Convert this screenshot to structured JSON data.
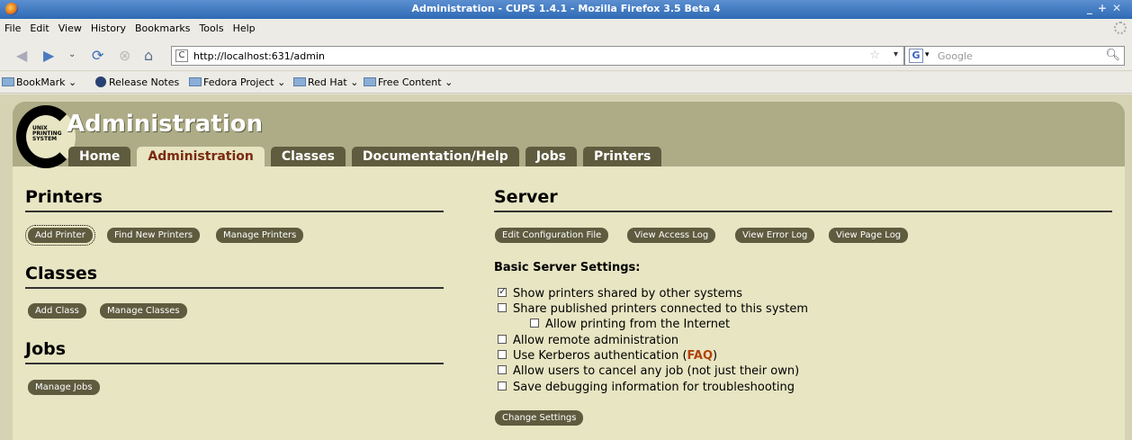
{
  "window": {
    "title": "Administration - CUPS  1.4.1  - Mozilla Firefox  3.5 Beta 4"
  },
  "menu": [
    "File",
    "Edit",
    "View",
    "History",
    "Bookmarks",
    "Tools",
    "Help"
  ],
  "nav": {
    "url": "http://localhost:631/admin",
    "search_placeholder": "Google"
  },
  "bookmarks": [
    "BookMark",
    "Release Notes",
    "Fedora Project",
    "Red Hat",
    "Free Content"
  ],
  "page": {
    "title": "Administration",
    "logo": "UNIX PRINTING SYSTEM",
    "tabs": [
      "Home",
      "Administration",
      "Classes",
      "Documentation/Help",
      "Jobs",
      "Printers"
    ],
    "printers": {
      "heading": "Printers",
      "buttons": [
        "Add Printer",
        "Find New Printers",
        "Manage Printers"
      ]
    },
    "classes": {
      "heading": "Classes",
      "buttons": [
        "Add Class",
        "Manage Classes"
      ]
    },
    "jobs": {
      "heading": "Jobs",
      "buttons": [
        "Manage Jobs"
      ]
    },
    "server": {
      "heading": "Server",
      "buttons": [
        "Edit Configuration File",
        "View Access Log",
        "View Error Log",
        "View Page Log"
      ],
      "settings_heading": "Basic Server Settings:",
      "settings": [
        {
          "label": "Show printers shared by other systems",
          "checked": true
        },
        {
          "label": "Share published printers connected to this system",
          "checked": false
        },
        {
          "label": "Allow printing from the Internet",
          "checked": false
        },
        {
          "label": "Allow remote administration",
          "checked": false
        },
        {
          "label": "Use Kerberos authentication (",
          "link": "FAQ",
          "suffix": ")",
          "checked": false
        },
        {
          "label": "Allow users to cancel any job (not just their own)",
          "checked": false
        },
        {
          "label": "Save debugging information for troubleshooting",
          "checked": false
        }
      ],
      "submit": "Change Settings"
    }
  }
}
